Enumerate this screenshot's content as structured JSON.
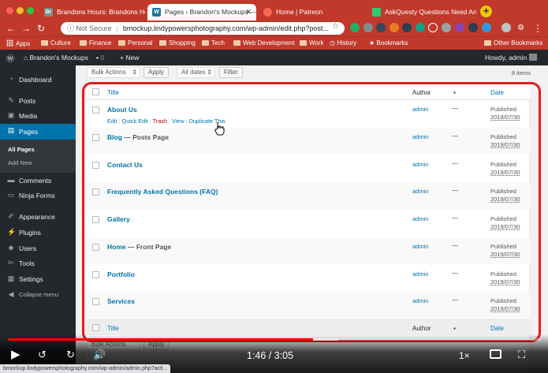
{
  "browser": {
    "tabs": [
      {
        "label": "Brandons Hours: Brandons Ho",
        "favicon_text": "Br",
        "favicon_color": "#7f8c8d",
        "active": false
      },
      {
        "label": "Pages ‹ Brandon's Mockups —",
        "favicon_text": "",
        "favicon_color": "#21759b",
        "active": true
      },
      {
        "label": "Home | Patreon",
        "favicon_text": "",
        "favicon_color": "#f96854",
        "active": false
      },
      {
        "label": "AskQuesty Questions Need An",
        "favicon_text": "",
        "favicon_color": "#2ecc71",
        "active": false
      }
    ],
    "new_tab": "+",
    "not_secure": "Not Secure",
    "url": "bmockup.lindypowersphotography.com/wp-admin/edit.php?post...",
    "bookmarks": [
      "Apps",
      "Culture",
      "Finance",
      "Personal",
      "Shopping",
      "Tech",
      "Web Development",
      "Work",
      "History",
      "Bookmarks"
    ],
    "other_bookmarks": "Other Bookmarks",
    "status_url": "bmockup.lindypowersphotography.com/wp-admin/admin.php?acti..."
  },
  "adminbar": {
    "site_name": "Brandon's Mockups",
    "comments_count": "0",
    "new_label": "New",
    "howdy": "Howdy, admin"
  },
  "sidebar": {
    "items": [
      {
        "label": "Dashboard",
        "icon": "dashboard-icon"
      },
      {
        "label": "Posts",
        "icon": "pin-icon"
      },
      {
        "label": "Media",
        "icon": "media-icon"
      },
      {
        "label": "Pages",
        "icon": "pages-icon"
      },
      {
        "label": "Comments",
        "icon": "comments-icon"
      },
      {
        "label": "Ninja Forms",
        "icon": "forms-icon"
      },
      {
        "label": "Appearance",
        "icon": "brush-icon"
      },
      {
        "label": "Plugins",
        "icon": "plugin-icon"
      },
      {
        "label": "Users",
        "icon": "users-icon"
      },
      {
        "label": "Tools",
        "icon": "tools-icon"
      },
      {
        "label": "Settings",
        "icon": "settings-icon"
      },
      {
        "label": "Collapse menu",
        "icon": "collapse-icon"
      }
    ],
    "submenu": [
      "All Pages",
      "Add New"
    ]
  },
  "toolbar": {
    "bulk_actions": "Bulk Actions",
    "apply": "Apply",
    "all_dates": "All dates",
    "filter": "Filter",
    "items_count": "8 items"
  },
  "table": {
    "headers": {
      "title": "Title",
      "author": "Author",
      "date": "Date"
    },
    "row_actions": {
      "edit": "Edit",
      "quick_edit": "Quick Edit",
      "trash": "Trash",
      "view": "View",
      "duplicate": "Duplicate This"
    },
    "rows": [
      {
        "title": "About Us",
        "state": "",
        "author": "admin",
        "comments": "—",
        "status": "Published",
        "date": "2019/07/30"
      },
      {
        "title": "Blog",
        "state": " — Posts Page",
        "author": "admin",
        "comments": "—",
        "status": "Published",
        "date": "2019/07/30"
      },
      {
        "title": "Contact Us",
        "state": "",
        "author": "admin",
        "comments": "—",
        "status": "Published",
        "date": "2019/07/30"
      },
      {
        "title": "Frequently Asked Questions (FAQ)",
        "state": "",
        "author": "admin",
        "comments": "—",
        "status": "Published",
        "date": "2019/07/30"
      },
      {
        "title": "Gallery",
        "state": "",
        "author": "admin",
        "comments": "—",
        "status": "Published",
        "date": "2019/07/30"
      },
      {
        "title": "Home",
        "state": " — Front Page",
        "author": "admin",
        "comments": "—",
        "status": "Published",
        "date": "2019/07/30"
      },
      {
        "title": "Portfolio",
        "state": "",
        "author": "admin",
        "comments": "—",
        "status": "Published",
        "date": "2019/07/30"
      },
      {
        "title": "Services",
        "state": "",
        "author": "admin",
        "comments": "—",
        "status": "Published",
        "date": "2019/07/30"
      }
    ]
  },
  "player": {
    "current_time": "1:46",
    "duration": "3:05",
    "time_display": "1:46 / 3:05",
    "speed": "1×",
    "progress": 0.573,
    "buffered": 0.62,
    "accent": "#ff0000"
  }
}
